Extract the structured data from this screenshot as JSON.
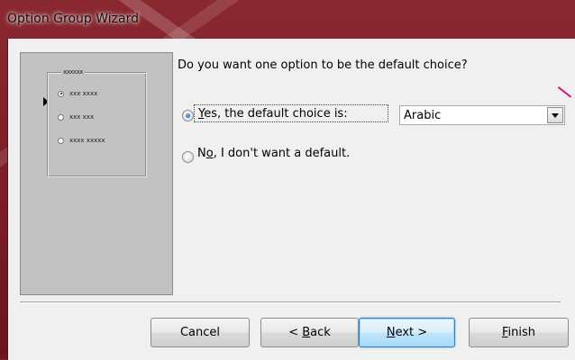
{
  "window": {
    "title": "Option Group Wizard"
  },
  "preview": {
    "group_label": "xxxxxx",
    "options": [
      {
        "label": "xxx xxxx",
        "selected": true
      },
      {
        "label": "xxx xxx",
        "selected": false
      },
      {
        "label": "xxxx xxxxx",
        "selected": false
      }
    ]
  },
  "main": {
    "question": "Do you want one option to be the default choice?",
    "yes_option": {
      "mnemonic": "Y",
      "label_rest": "es, the default choice is:",
      "selected": true
    },
    "no_option": {
      "label_pre": "N",
      "mnemonic": "o",
      "label_rest": ", I don't want a default.",
      "selected": false
    },
    "default_choice": {
      "value": "Arabic"
    }
  },
  "buttons": {
    "cancel": "Cancel",
    "back_pre": "< ",
    "back_mnemonic": "B",
    "back_rest": "ack",
    "next_mnemonic": "N",
    "next_rest": "ext >",
    "finish_mnemonic": "F",
    "finish_rest": "inish"
  },
  "colors": {
    "accent_focus": "#3c7fb1",
    "window_frame": "#7a1c22",
    "annotation": "#d21a7a"
  }
}
